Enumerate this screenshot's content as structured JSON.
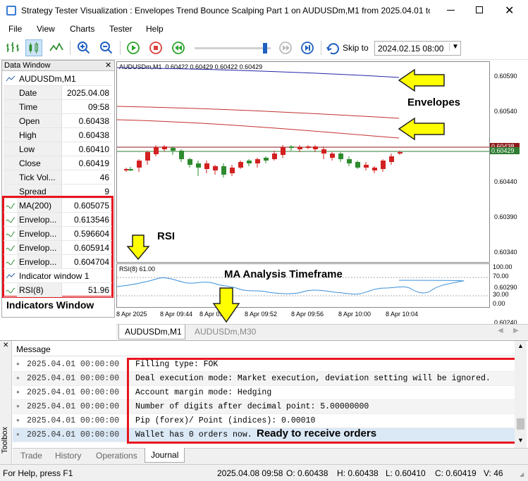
{
  "window": {
    "title": "Strategy Tester Visualization : Envelopes Trend Bounce Scalping Part 1 on AUDUSDm,M1 from 2025.04.01 to 2..."
  },
  "menu": [
    "File",
    "View",
    "Charts",
    "Tester",
    "Help"
  ],
  "toolbar": {
    "skip_label": "Skip to",
    "skip_date": "2024.02.15 08:00"
  },
  "data_window": {
    "title": "Data Window",
    "symbol": "AUDUSDm,M1",
    "rows": [
      {
        "k": "Date",
        "v": "2025.04.08"
      },
      {
        "k": "Time",
        "v": "09:58"
      },
      {
        "k": "Open",
        "v": "0.60438"
      },
      {
        "k": "High",
        "v": "0.60438"
      },
      {
        "k": "Low",
        "v": "0.60410"
      },
      {
        "k": "Close",
        "v": "0.60419"
      },
      {
        "k": "Tick Vol...",
        "v": "46"
      },
      {
        "k": "Spread",
        "v": "9"
      }
    ],
    "indicators": [
      {
        "k": "MA(200)",
        "v": "0.605075"
      },
      {
        "k": "Envelop...",
        "v": "0.613546"
      },
      {
        "k": "Envelop...",
        "v": "0.596604"
      },
      {
        "k": "Envelop...",
        "v": "0.605914"
      },
      {
        "k": "Envelop...",
        "v": "0.604704"
      }
    ],
    "indicator_window": "Indicator window 1",
    "rsi": {
      "k": "RSI(8)",
      "v": "51.96"
    }
  },
  "chart": {
    "header": "AUDUSDm,M1  0.60422 0.60429 0.60422 0.60429",
    "price_ticks": [
      "0.60590",
      "0.60540",
      "0.60490",
      "0.60440",
      "0.60390",
      "0.60340",
      "0.60290",
      "0.60240"
    ],
    "price_tags": [
      "0.60438",
      "0.60429"
    ],
    "rsi_header": "RSI(8) 61.00",
    "rsi_ticks": [
      "100.00",
      "70.00",
      "30.00",
      "0.00"
    ],
    "time_ticks": [
      "8 Apr 2025",
      "8 Apr 09:44",
      "8 Apr 09:48",
      "8 Apr 09:52",
      "8 Apr 09:56",
      "8 Apr 10:00",
      "8 Apr 10:04"
    ],
    "tabs": [
      "AUDUSDm,M1",
      "AUDUSDm,M30"
    ]
  },
  "annotations": {
    "envelopes": "Envelopes",
    "rsi": "RSI",
    "ma": "MA Analysis Timeframe",
    "indicators": "Indicators Window",
    "ready": "Ready to receive orders"
  },
  "journal": {
    "header": "Message",
    "side_label": "Toolbox",
    "rows": [
      {
        "time": "2025.04.01 00:00:00",
        "msg": "Filling type: FOK"
      },
      {
        "time": "2025.04.01 00:00:00",
        "msg": "Deal execution mode: Market execution, deviation setting will be ignored."
      },
      {
        "time": "2025.04.01 00:00:00",
        "msg": "Account margin mode: Hedging"
      },
      {
        "time": "2025.04.01 00:00:00",
        "msg": "Number of digits after decimal point: 5.00000000"
      },
      {
        "time": "2025.04.01 00:00:00",
        "msg": "Pip (forex)/ Point (indices): 0.00010"
      },
      {
        "time": "2025.04.01 00:00:00",
        "msg": "Wallet has 0 orders now."
      }
    ],
    "tabs": [
      "Trade",
      "History",
      "Operations",
      "Journal"
    ]
  },
  "status": {
    "help": "For Help, press F1",
    "dt": "2025.04.08 09:58",
    "o": "O: 0.60438",
    "h": "H: 0.60438",
    "l": "L: 0.60410",
    "c": "C: 0.60419",
    "v": "V: 46"
  },
  "colors": {
    "accent": "#0078d7",
    "callout_red": "#e8141e",
    "arrow_yellow": "#ffff00"
  }
}
